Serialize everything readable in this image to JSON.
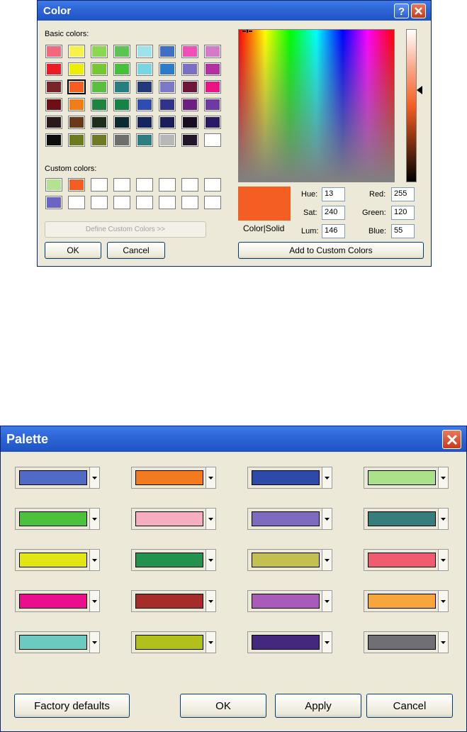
{
  "color_dialog": {
    "title": "Color",
    "basic_colors_label": "Basic colors:",
    "custom_colors_label": "Custom colors:",
    "basic_colors": [
      [
        "#f2687d",
        "#f6f24a",
        "#8ad84f",
        "#5ac455",
        "#9ee3ea",
        "#3d70c4",
        "#f04fb8",
        "#d47ac8"
      ],
      [
        "#ed1c24",
        "#eeee00",
        "#76c833",
        "#47bf3a",
        "#78d6e0",
        "#2b7acb",
        "#7b6fc4",
        "#b42fa2"
      ],
      [
        "#7a2329",
        "#f55e23",
        "#5abf3c",
        "#257f7e",
        "#22397a",
        "#7c79c9",
        "#6e1538",
        "#ec1383"
      ],
      [
        "#6d1016",
        "#f07d18",
        "#1f8240",
        "#168244",
        "#2f4cb0",
        "#2f338a",
        "#6d1f7f",
        "#6d3aa2"
      ],
      [
        "#29191a",
        "#6a3919",
        "#1f2d1b",
        "#0a2a2e",
        "#13245e",
        "#1a1d5a",
        "#1a0d20",
        "#2b1a63"
      ],
      [
        "#0d0d0d",
        "#6b7b1f",
        "#6e7a25",
        "#6e6e6e",
        "#2e7d80",
        "#b8b8b8",
        "#211729",
        "#ffffff"
      ]
    ],
    "custom_colors": [
      [
        "#b5e193",
        "#f55e23",
        "#ffffff",
        "#ffffff",
        "#ffffff",
        "#ffffff",
        "#ffffff",
        "#ffffff"
      ],
      [
        "#6a65c2",
        "#ffffff",
        "#ffffff",
        "#ffffff",
        "#ffffff",
        "#ffffff",
        "#ffffff",
        "#ffffff"
      ]
    ],
    "define_custom_label": "Define Custom Colors >>",
    "ok_label": "OK",
    "cancel_label": "Cancel",
    "add_custom_label": "Add to Custom Colors",
    "color_solid_label": "Color|Solid",
    "preview_color": "#f55e23",
    "hue_label": "Hue:",
    "sat_label": "Sat:",
    "lum_label": "Lum:",
    "red_label": "Red:",
    "green_label": "Green:",
    "blue_label": "Blue:",
    "hue": "13",
    "sat": "240",
    "lum": "146",
    "red": "255",
    "green": "120",
    "blue": "55",
    "icons": {
      "help": "help-icon",
      "close": "close-icon",
      "lum_pointer": "triangle-left-icon"
    }
  },
  "palette_dialog": {
    "title": "Palette",
    "colors": [
      "#4f6bc5",
      "#f47a1f",
      "#2e4aa8",
      "#ace18b",
      "#4cc13b",
      "#f5adc0",
      "#7e6bbf",
      "#367d7b",
      "#e4e613",
      "#23924c",
      "#c4c04f",
      "#ef5c70",
      "#ea0d8d",
      "#a62c2a",
      "#a85bb8",
      "#f8a53b",
      "#6bcbc3",
      "#b2c01b",
      "#43287d",
      "#707074"
    ],
    "factory_defaults_label": "Factory defaults",
    "ok_label": "OK",
    "apply_label": "Apply",
    "cancel_label": "Cancel"
  }
}
